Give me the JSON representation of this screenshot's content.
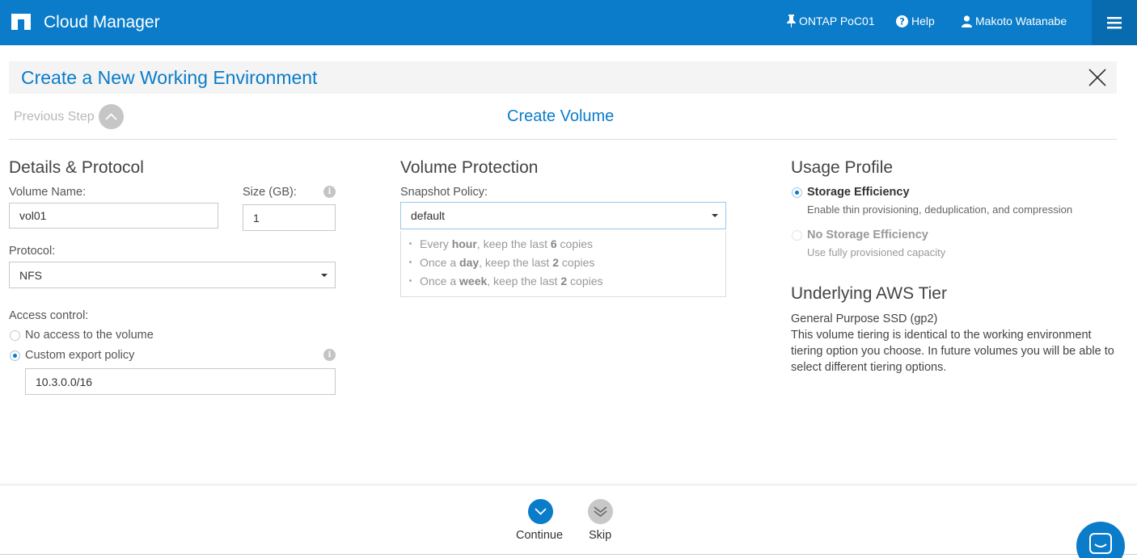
{
  "app": {
    "title": "Cloud Manager",
    "working_env": "ONTAP PoC01",
    "help": "Help",
    "user": "Makoto Watanabe",
    "accent_color": "#0a7cc9"
  },
  "wizard": {
    "title": "Create a New Working Environment",
    "previous_step": "Previous Step",
    "step_title": "Create Volume"
  },
  "details": {
    "heading": "Details & Protocol",
    "volume_name_label": "Volume Name:",
    "volume_name_value": "vol01",
    "size_label": "Size (GB):",
    "size_value": "1",
    "protocol_label": "Protocol:",
    "protocol_value": "NFS",
    "access_label": "Access control:",
    "access_options": [
      {
        "label": "No access to the volume",
        "selected": false
      },
      {
        "label": "Custom export policy",
        "selected": true
      }
    ],
    "export_policy_value": "10.3.0.0/16"
  },
  "protection": {
    "heading": "Volume Protection",
    "snapshot_label": "Snapshot Policy:",
    "snapshot_value": "default",
    "schedule": [
      {
        "pre": "Every ",
        "unit": "hour",
        "mid": ", keep the last ",
        "count": "6",
        "post": " copies"
      },
      {
        "pre": "Once a ",
        "unit": "day",
        "mid": ", keep the last ",
        "count": "2",
        "post": " copies"
      },
      {
        "pre": "Once a ",
        "unit": "week",
        "mid": ", keep the last ",
        "count": "2",
        "post": " copies"
      }
    ]
  },
  "usage": {
    "heading": "Usage Profile",
    "options": [
      {
        "title": "Storage Efficiency",
        "desc": "Enable thin provisioning, deduplication, and compression",
        "selected": true
      },
      {
        "title": "No Storage Efficiency",
        "desc": "Use fully provisioned capacity",
        "selected": false
      }
    ],
    "tier_heading": "Underlying AWS Tier",
    "tier_name": "General Purpose SSD (gp2)",
    "tier_desc": "This volume tiering is identical to the working environment tiering option you choose. In future volumes you will be able to select different tiering options."
  },
  "footer": {
    "continue": "Continue",
    "skip": "Skip"
  }
}
